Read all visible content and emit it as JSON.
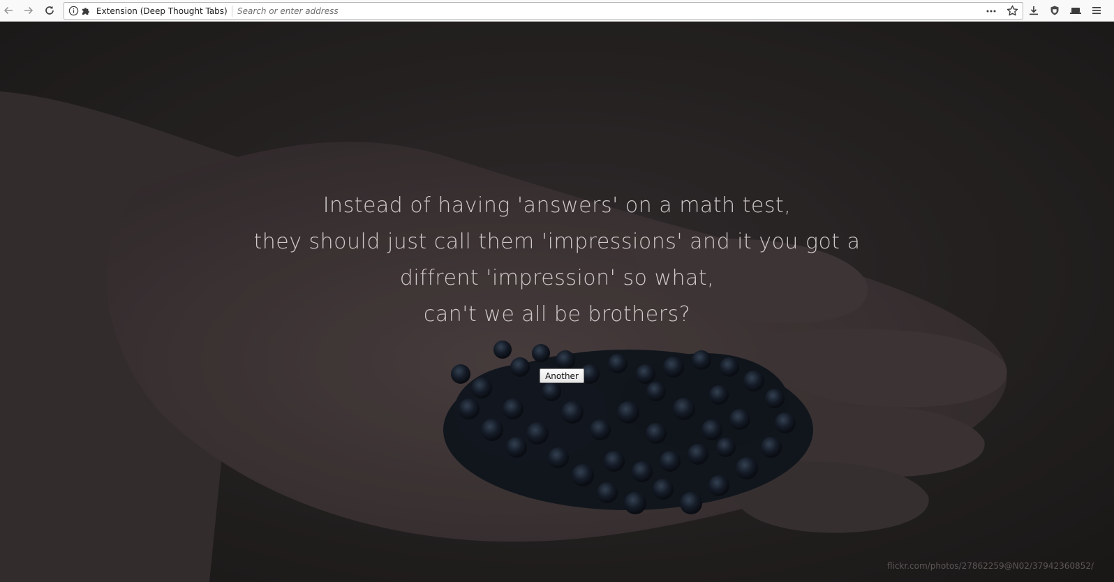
{
  "toolbar": {
    "back_icon": "arrow-left-icon",
    "forward_icon": "arrow-right-icon",
    "reload_icon": "reload-icon",
    "identity_label": "Extension (Deep Thought Tabs)",
    "address_placeholder": "Search or enter address",
    "address_value": "",
    "icons": [
      "page-actions-icon",
      "bookmark-star-icon",
      "downloads-icon",
      "shield-icon",
      "library-icon",
      "hamburger-menu-icon"
    ]
  },
  "page": {
    "quote_lines": [
      "Instead of having 'answers' on a math test,",
      "they should just call them 'impressions' and it you got a",
      "diffrent 'impression' so what,",
      "can't we all be brothers?"
    ],
    "another_label": "Another",
    "photo_credit": "flickr.com/photos/27862259@N02/37942360852/",
    "text_color": "#cfc9c9",
    "background_color": "#322c2c"
  }
}
